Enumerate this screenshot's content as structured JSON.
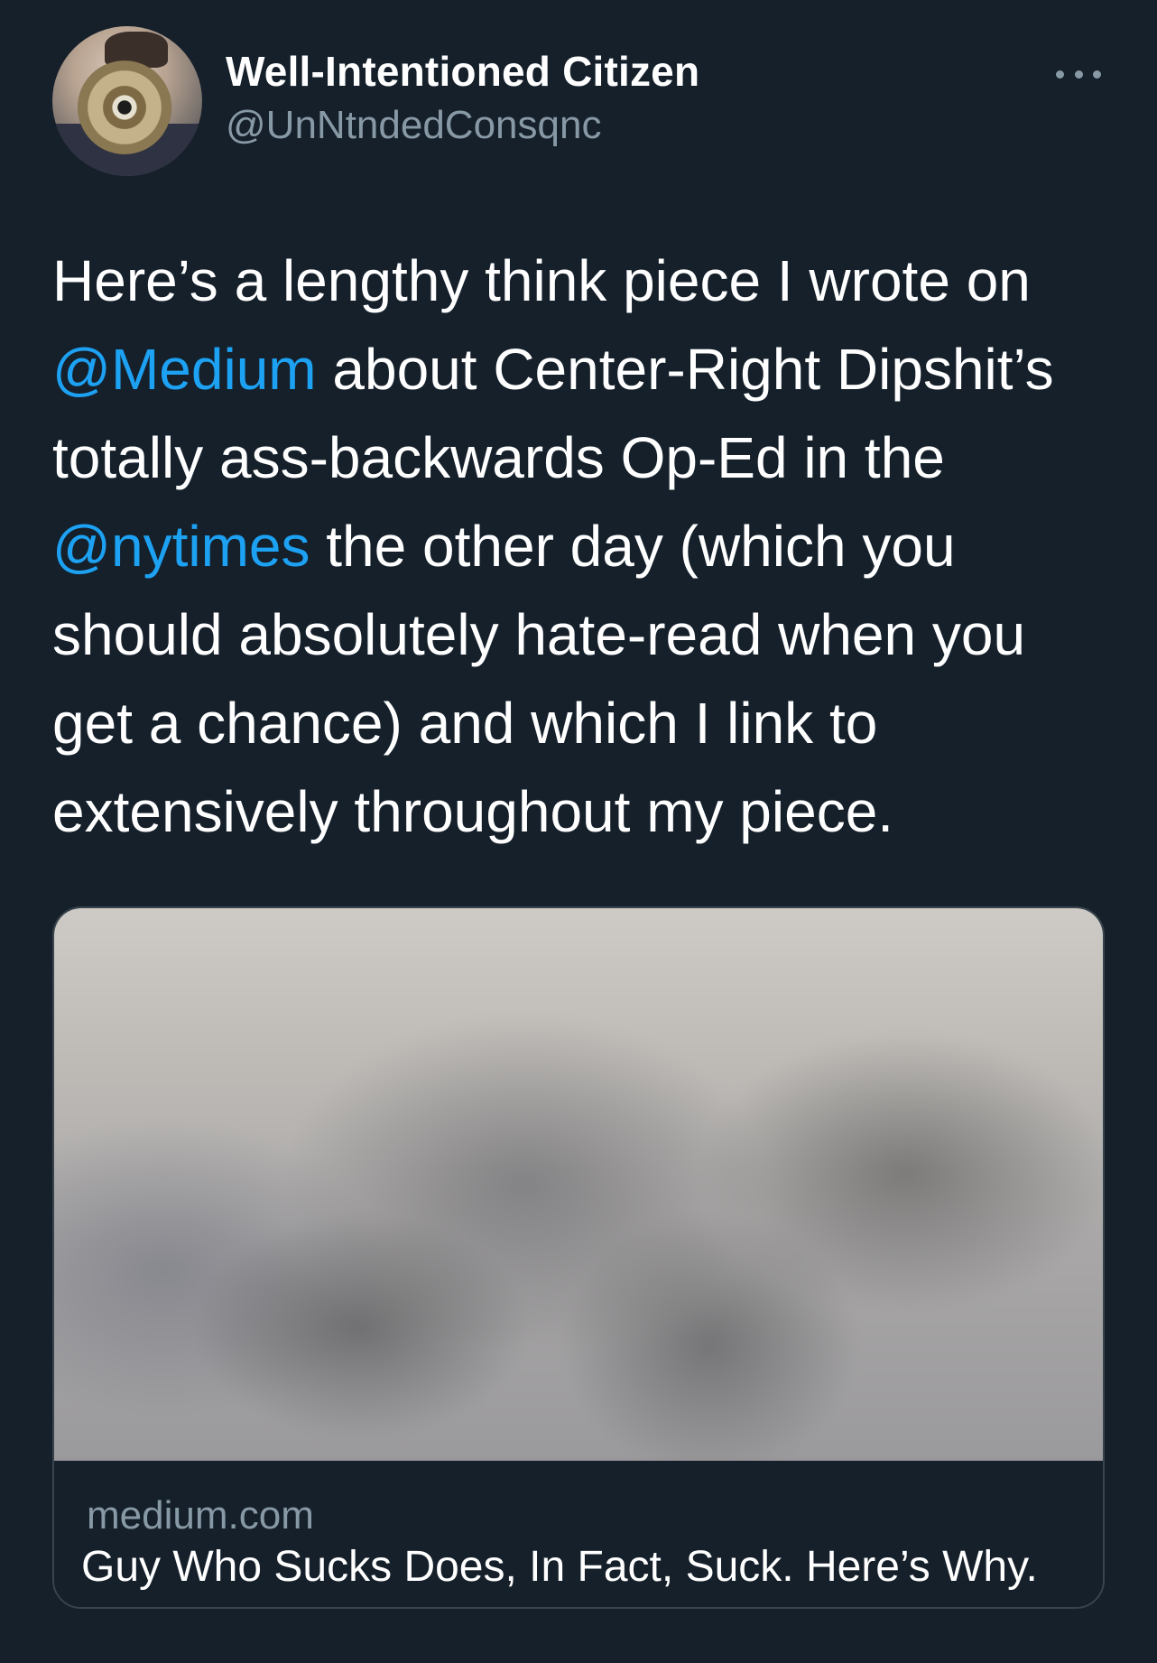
{
  "tweet": {
    "author": {
      "display_name": "Well-Intentioned Citizen",
      "handle": "@UnNtndedConsqnc"
    },
    "more_icon": "more-horizontal-icon",
    "text_lines": [
      {
        "segments": [
          {
            "text": "Here’s a lengthy think piece I wrote on",
            "type": "text"
          }
        ]
      },
      {
        "segments": [
          {
            "text": "@Medium",
            "type": "mention"
          },
          {
            "text": " about Center-Right Dipshit’s",
            "type": "text"
          }
        ]
      },
      {
        "segments": [
          {
            "text": "totally ass-backwards Op-Ed in the",
            "type": "text"
          }
        ]
      },
      {
        "segments": [
          {
            "text": "@nytimes",
            "type": "mention"
          },
          {
            "text": " the other day (which you",
            "type": "text"
          }
        ]
      },
      {
        "segments": [
          {
            "text": "should absolutely hate-read when you",
            "type": "text"
          }
        ]
      },
      {
        "segments": [
          {
            "text": "get a chance) and which I link to",
            "type": "text"
          }
        ]
      },
      {
        "segments": [
          {
            "text": "extensively throughout my piece.",
            "type": "text"
          }
        ]
      }
    ],
    "link_card": {
      "domain": "medium.com",
      "title": "Guy Who Sucks Does, In Fact, Suck. Here’s Why."
    }
  },
  "colors": {
    "background": "#15202b",
    "mention": "#1da1f2",
    "secondary_text": "#8899a6",
    "border": "#38444d"
  }
}
